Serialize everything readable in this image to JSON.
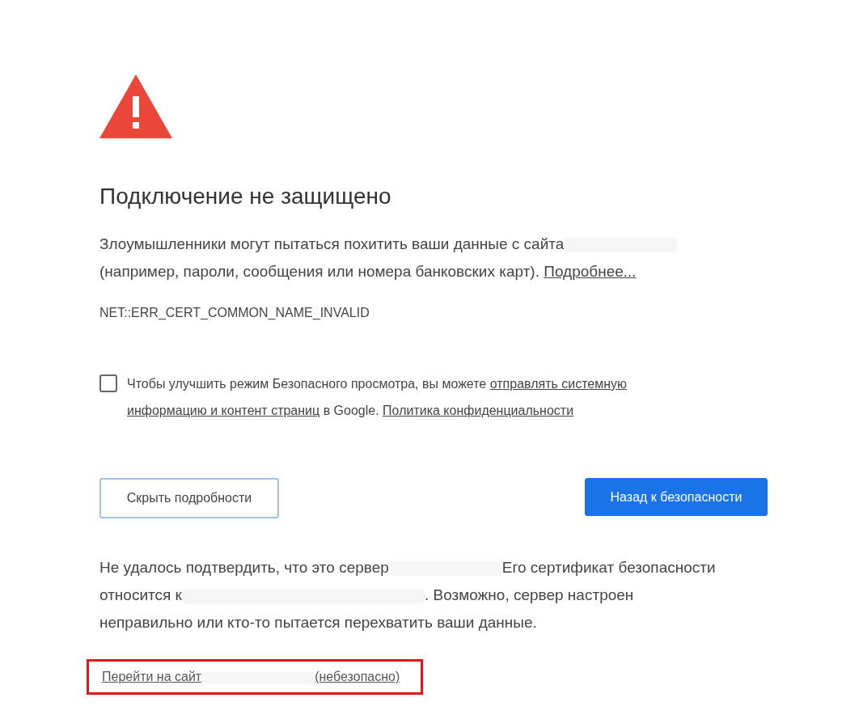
{
  "title": "Подключение не защищено",
  "intro": [
    [
      {
        "kind": "text",
        "text": "Злоумышленники могут пытаться похитить ваши данные с сайта"
      },
      {
        "kind": "redacted"
      }
    ],
    [
      {
        "kind": "text",
        "text": "(например, пароли, сообщения или номера банковских карт). "
      },
      {
        "kind": "link",
        "text": "Подробнее..."
      }
    ]
  ],
  "error_code": "NET::ERR_CERT_COMMON_NAME_INVALID",
  "opt_in": {
    "checked": false,
    "lines": [
      [
        {
          "kind": "text",
          "text": "Чтобы улучшить режим Безопасного просмотра, вы можете "
        },
        {
          "kind": "link",
          "text": "отправлять системную"
        }
      ],
      [
        {
          "kind": "link",
          "text": "информацию и контент страниц"
        },
        {
          "kind": "text",
          "text": " в Google. "
        },
        {
          "kind": "link",
          "text": "Политика конфиденциальности"
        }
      ]
    ]
  },
  "buttons": [
    {
      "kind": "secondary",
      "label": "Скрыть подробности"
    },
    {
      "kind": "primary",
      "label": "Назад к безопасности"
    }
  ],
  "details": [
    [
      {
        "kind": "text",
        "text": "Не удалось подтвердить, что это сервер"
      },
      {
        "kind": "redacted"
      },
      {
        "kind": "text",
        "text": "Его сертификат безопасности"
      }
    ],
    [
      {
        "kind": "text",
        "text": "относится к"
      },
      {
        "kind": "redacted",
        "wide": true
      },
      {
        "kind": "text",
        "text": ". Возможно, сервер настроен"
      }
    ],
    [
      {
        "kind": "text",
        "text": "неправильно или кто-то пытается перехватить ваши данные."
      }
    ]
  ],
  "proceed": {
    "highlighted": true,
    "parts": [
      {
        "kind": "link",
        "text": "Перейти на сайт"
      },
      {
        "kind": "redacted"
      },
      {
        "kind": "link",
        "text": "(небезопасно)"
      }
    ]
  }
}
